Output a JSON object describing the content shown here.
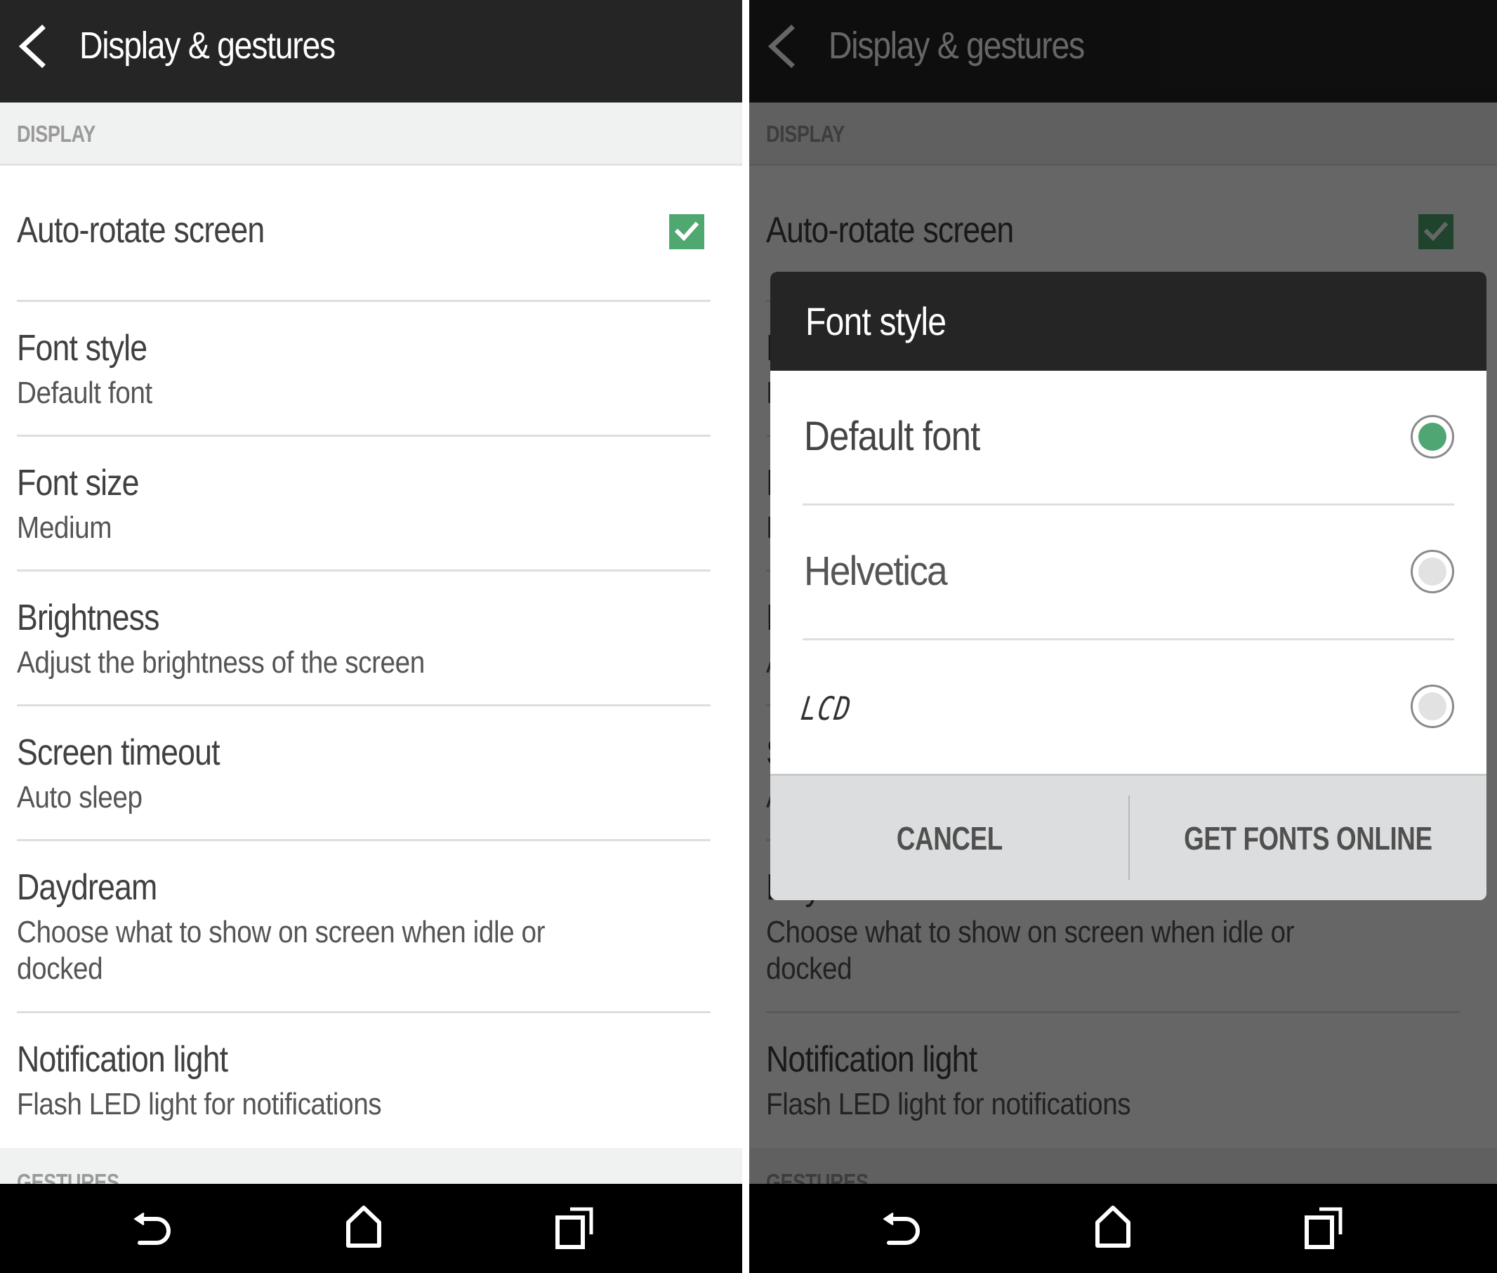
{
  "colors": {
    "accent_green": "#4FA870",
    "appbar_bg": "#252525",
    "section_bg": "#F0F1F1",
    "dialog_buttons_bg": "#DCDDDE",
    "navbar_bg": "#000000"
  },
  "appbar": {
    "back_icon": "chevron-left-icon",
    "title": "Display & gestures"
  },
  "sections": {
    "display": "DISPLAY",
    "gestures": "GESTURES"
  },
  "settings": [
    {
      "title": "Auto-rotate screen",
      "subtitle": null,
      "checked": true
    },
    {
      "title": "Font style",
      "subtitle": "Default font"
    },
    {
      "title": "Font size",
      "subtitle": "Medium"
    },
    {
      "title": "Brightness",
      "subtitle": "Adjust the brightness of the screen"
    },
    {
      "title": "Screen timeout",
      "subtitle": "Auto sleep"
    },
    {
      "title": "Daydream",
      "subtitle": "Choose what to show on screen when idle or docked"
    },
    {
      "title": "Notification light",
      "subtitle": "Flash LED light for notifications"
    }
  ],
  "dialog": {
    "title": "Font style",
    "options": [
      {
        "label": "Default font",
        "selected": true
      },
      {
        "label": "Helvetica",
        "selected": false
      },
      {
        "label": "LCD",
        "selected": false
      }
    ],
    "buttons": {
      "cancel": "CANCEL",
      "get_fonts": "GET FONTS ONLINE"
    }
  },
  "navbar": {
    "back_icon": "back-arrow-icon",
    "home_icon": "home-icon",
    "recents_icon": "recent-apps-icon"
  }
}
